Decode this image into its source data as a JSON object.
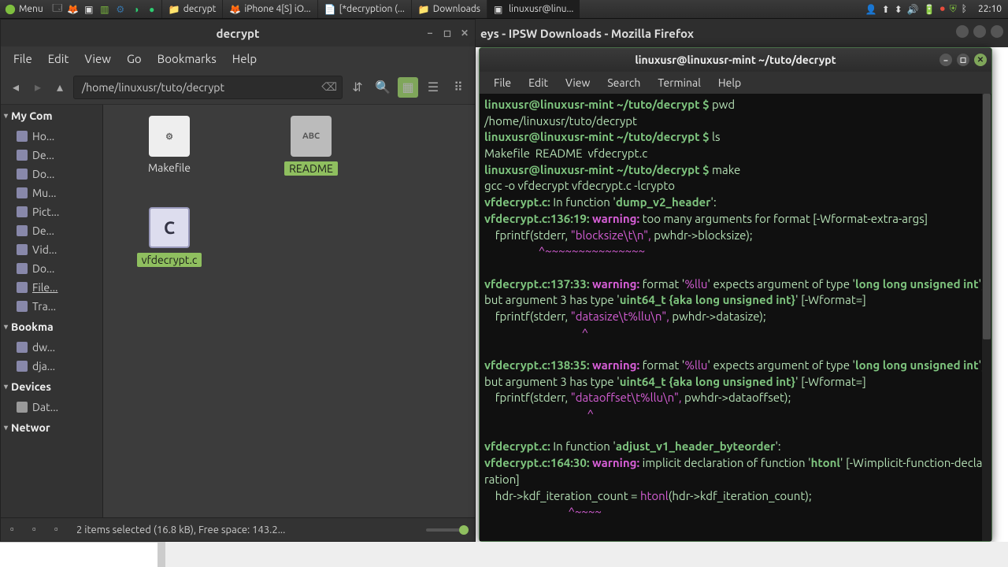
{
  "panel": {
    "menu_label": "Menu",
    "tasks": [
      {
        "label": "decrypt",
        "icon": "folder"
      },
      {
        "label": "iPhone 4[S] iO...",
        "icon": "firefox"
      },
      {
        "label": "[*decryption (...",
        "icon": "text"
      },
      {
        "label": "Downloads",
        "icon": "folder"
      },
      {
        "label": "linuxusr@linu...",
        "icon": "terminal",
        "active": true
      }
    ],
    "clock": "22:10"
  },
  "firefox_title": "eys - IPSW Downloads - Mozilla Firefox",
  "fm": {
    "title": "decrypt",
    "menus": [
      "File",
      "Edit",
      "View",
      "Go",
      "Bookmarks",
      "Help"
    ],
    "path": "/home/linuxusr/tuto/decrypt",
    "sidebar": {
      "sections": [
        {
          "header": "My Com",
          "items": [
            {
              "label": "Ho..."
            },
            {
              "label": "De..."
            },
            {
              "label": "Do..."
            },
            {
              "label": "Mu..."
            },
            {
              "label": "Pict..."
            },
            {
              "label": "De..."
            },
            {
              "label": "Vid..."
            },
            {
              "label": "Do..."
            },
            {
              "label": "File...",
              "selected": true
            },
            {
              "label": "Tra..."
            }
          ]
        },
        {
          "header": "Bookma",
          "items": [
            {
              "label": "dw..."
            },
            {
              "label": "dja..."
            }
          ]
        },
        {
          "header": "Devices",
          "items": [
            {
              "label": "Dat...",
              "dev": true
            }
          ]
        },
        {
          "header": "Networ",
          "items": []
        }
      ]
    },
    "files": [
      {
        "name": "Makefile",
        "kind": "makefile",
        "selected": false
      },
      {
        "name": "README",
        "kind": "readme",
        "selected": true,
        "badge": "ABC"
      },
      {
        "name": "vfdecrypt.c",
        "kind": "c",
        "selected": true,
        "badge": "C"
      }
    ],
    "status": "2 items selected (16.8 kB), Free space: 143.2..."
  },
  "term": {
    "title": "linuxusr@linuxusr-mint ~/tuto/decrypt",
    "menus": [
      "File",
      "Edit",
      "View",
      "Search",
      "Terminal",
      "Help"
    ],
    "prompt": "linuxusr@linuxusr-mint ~/tuto/decrypt $",
    "lines": [
      {
        "t": "prompt",
        "cmd": "pwd"
      },
      {
        "t": "out",
        "text": "/home/linuxusr/tuto/decrypt"
      },
      {
        "t": "prompt",
        "cmd": "ls"
      },
      {
        "t": "out",
        "text": "Makefile  README  vfdecrypt.c"
      },
      {
        "t": "prompt",
        "cmd": "make"
      },
      {
        "t": "out",
        "text": "gcc -o vfdecrypt vfdecrypt.c -lcrypto"
      },
      {
        "t": "warnhdr",
        "file": "vfdecrypt.c:",
        "rest": " In function '",
        "func": "dump_v2_header",
        "tail": "':"
      },
      {
        "t": "warn",
        "loc": "vfdecrypt.c:136:19:",
        "msg": " warning: too many arguments for format [-Wformat-extra-args]"
      },
      {
        "t": "code",
        "text": "    fprintf(stderr, \"blocksize\\t\\n\", pwhdr->blocksize);",
        "strStart": 20,
        "strEnd": 36
      },
      {
        "t": "tilde",
        "text": "                    ^~~~~~~~~~~~~~~~"
      },
      {
        "t": "blank"
      },
      {
        "t": "warn",
        "loc": "vfdecrypt.c:137:33:",
        "msg": " warning: format '%llu' expects argument of type 'long long unsigned int', but argument 3 has type 'uint64_t {aka long unsigned int}' [-Wformat=]"
      },
      {
        "t": "code",
        "text": "    fprintf(stderr, \"datasize\\t%llu\\n\", pwhdr->datasize);",
        "strStart": 20,
        "strEnd": 39
      },
      {
        "t": "tilde",
        "text": "                                    ^"
      },
      {
        "t": "blank"
      },
      {
        "t": "warn",
        "loc": "vfdecrypt.c:138:35:",
        "msg": " warning: format '%llu' expects argument of type 'long long unsigned int', but argument 3 has type 'uint64_t {aka long unsigned int}' [-Wformat=]"
      },
      {
        "t": "code",
        "text": "    fprintf(stderr, \"dataoffset\\t%llu\\n\", pwhdr->dataoffset);",
        "strStart": 20,
        "strEnd": 41
      },
      {
        "t": "tilde",
        "text": "                                      ^"
      },
      {
        "t": "blank"
      },
      {
        "t": "warnhdr",
        "file": "vfdecrypt.c:",
        "rest": " In function '",
        "func": "adjust_v1_header_byteorder",
        "tail": "':"
      },
      {
        "t": "warn",
        "loc": "vfdecrypt.c:164:30:",
        "msg": " warning: implicit declaration of function 'htonl' [-Wimplicit-function-declaration]"
      },
      {
        "t": "code",
        "text": "    hdr->kdf_iteration_count = htonl(hdr->kdf_iteration_count);",
        "strStart": 31,
        "strEnd": 36
      },
      {
        "t": "tilde",
        "text": "                               ^~~~~"
      }
    ]
  }
}
